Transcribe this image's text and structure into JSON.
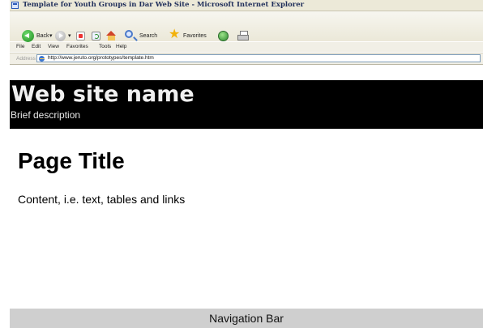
{
  "window": {
    "title": "Template for Youth Groups in Dar Web Site - Microsoft Internet Explorer"
  },
  "toolbar": {
    "back_label": "Back",
    "back_dropdown": "▾",
    "forward_dropdown": "▾",
    "search_label": "Search",
    "favorites_label": "Favorites",
    "icons": [
      "back-icon",
      "forward-icon",
      "stop-icon",
      "refresh-icon",
      "home-icon",
      "search-icon",
      "star-icon",
      "media-icon",
      "print-icon"
    ]
  },
  "menu": {
    "items": [
      "File",
      "Edit",
      "View",
      "Favorites",
      "Tools",
      "Help"
    ]
  },
  "address": {
    "label": "Address",
    "url": "http://www.jeruto.org/prototypes/template.htm"
  },
  "page": {
    "site_name": "Web site name",
    "site_description": "Brief description",
    "title": "Page Title",
    "content": "Content, i.e. text, tables and links",
    "nav_label": "Navigation Bar"
  },
  "colors": {
    "header_bg": "#000000",
    "nav_bg": "#cfcfcf",
    "page_bg": "#ffffff"
  }
}
